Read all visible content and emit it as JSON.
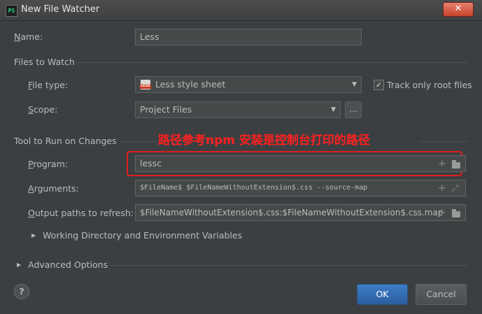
{
  "window": {
    "title": "New File Watcher",
    "close_glyph": "✕",
    "app_icon_text": "PS"
  },
  "name": {
    "label_u": "N",
    "label_rest": "ame:",
    "value": "Less"
  },
  "files_to_watch": {
    "section_title": "Files to Watch",
    "file_type": {
      "label_u": "F",
      "label_rest": "ile type:",
      "value": "Less style sheet",
      "icon_text": "LESS",
      "icon": "less-file-icon"
    },
    "track_root": {
      "label": "Track only root files",
      "checked": true,
      "check_glyph": "✓"
    },
    "scope": {
      "label_u": "S",
      "label_rest": "cope:",
      "value": "Project Files",
      "browse_label": "..."
    }
  },
  "tool": {
    "section_title": "Tool to Run on Changes",
    "program": {
      "label_u": "P",
      "label_rest": "rogram:",
      "value": "lessc"
    },
    "arguments": {
      "label_u": "A",
      "label_rest": "rguments:",
      "value": "$FileName$ $FileNameWithoutExtension$.css --source-map"
    },
    "output": {
      "label_u": "O",
      "label_rest": "utput paths to refresh:",
      "value": "$FileNameWithoutExtension$.css:$FileNameWithoutExtension$.css.map"
    },
    "working_dir": {
      "label": "Working Directory and Environment Variables",
      "expander": "▶"
    }
  },
  "advanced": {
    "label": "Advanced Options",
    "expander": "▶"
  },
  "annotation": "路径参考npm 安装是控制台打印的路径",
  "buttons": {
    "ok": "OK",
    "cancel": "Cancel",
    "help": "?"
  },
  "icons": {
    "plus": "+",
    "expand": "⤢",
    "dropdown": "▼"
  }
}
